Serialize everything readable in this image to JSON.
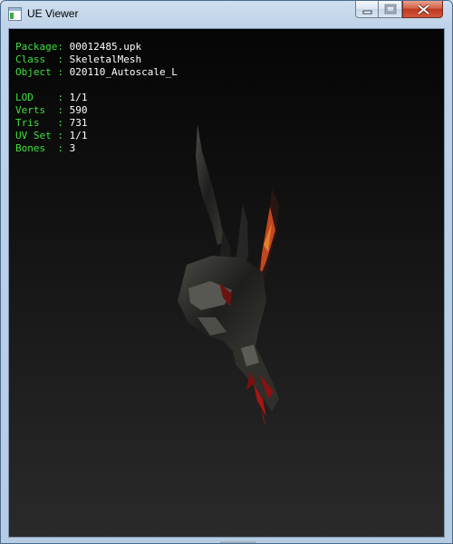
{
  "window": {
    "title": "UE Viewer"
  },
  "info": {
    "package": {
      "key": "Package: ",
      "value": "00012485.upk"
    },
    "class": {
      "key": "Class  : ",
      "value": "SkeletalMesh"
    },
    "object": {
      "key": "Object : ",
      "value": "020110_Autoscale_L"
    },
    "lod": {
      "key": "LOD    : ",
      "value": "1/1"
    },
    "verts": {
      "key": "Verts  : ",
      "value": "590"
    },
    "tris": {
      "key": "Tris   : ",
      "value": "731"
    },
    "uvset": {
      "key": "UV Set : ",
      "value": "1/1"
    },
    "bones": {
      "key": "Bones  : ",
      "value": "3"
    }
  },
  "colors": {
    "label": "#3fe03f",
    "value": "#ffffff",
    "close_button": "#c1391c",
    "viewport_top": "#050505",
    "viewport_bottom": "#2a2a2a"
  },
  "icons": {
    "app": "window-app-icon",
    "minimize": "minimize-icon",
    "maximize": "maximize-icon",
    "close": "close-icon"
  }
}
